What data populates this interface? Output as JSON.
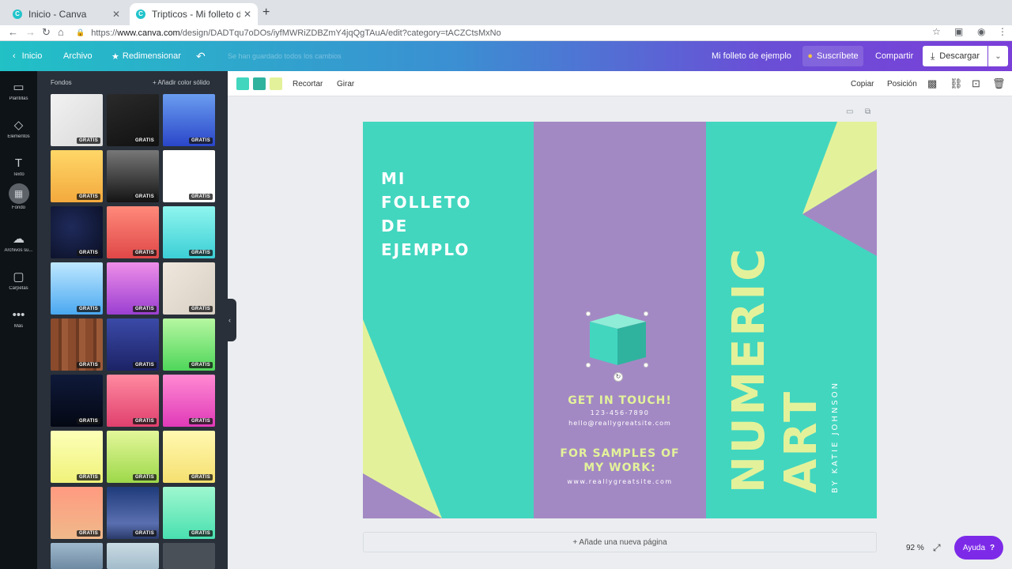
{
  "browser": {
    "tabs": [
      {
        "title": "Inicio - Canva"
      },
      {
        "title": "Tripticos - Mi folleto de ejemplo"
      }
    ],
    "url_prefix": "https://",
    "url_domain": "www.canva.com",
    "url_path": "/design/DADTqu7oDOs/iyfMWRiZDBZmY4jqQgTAuA/edit?category=tACZCtsMxNo"
  },
  "topbar": {
    "inicio": "Inicio",
    "archivo": "Archivo",
    "redimensionar": "Redimensionar",
    "saved_status": "Se han guardado todos los cambios",
    "design_title": "Mi folleto de ejemplo",
    "suscribete": "Suscríbete",
    "compartir": "Compartir",
    "descargar": "Descargar"
  },
  "rail": {
    "items": [
      {
        "label": "Plantillas",
        "icon": "template-icon"
      },
      {
        "label": "Elementos",
        "icon": "elements-icon"
      },
      {
        "label": "Texto",
        "icon": "text-icon"
      },
      {
        "label": "Fondo",
        "icon": "background-icon"
      },
      {
        "label": "Archivos su...",
        "icon": "upload-cloud-icon"
      },
      {
        "label": "Carpetas",
        "icon": "folder-icon"
      },
      {
        "label": "Más",
        "icon": "more-icon"
      }
    ]
  },
  "panel": {
    "heading": "Fondos",
    "add_solid": "+ Añadir color sólido",
    "badge": "GRATIS"
  },
  "toolbar": {
    "swatches": [
      "#42d6bf",
      "#2fb39e",
      "#e3f29a"
    ],
    "recortar": "Recortar",
    "girar": "Girar",
    "copiar": "Copiar",
    "posicion": "Posición"
  },
  "design": {
    "title_lines": [
      "MI",
      "FOLLETO",
      "DE",
      "EJEMPLO"
    ],
    "get_in_touch": "GET IN TOUCH!",
    "phone": "123-456-7890",
    "email": "hello@reallygreatsite.com",
    "samples_line1": "FOR SAMPLES OF",
    "samples_line2": "MY WORK:",
    "website": "www.reallygreatsite.com",
    "vertical_1": "NUMERIC",
    "vertical_2": "ART",
    "byline": "BY KATIE JOHNSON",
    "colors": {
      "teal": "#42d6bf",
      "purple": "#a389c4",
      "yellow": "#e3f29a",
      "white": "#ffffff"
    }
  },
  "footer": {
    "add_page": "+ Añade una nueva página",
    "zoom": "92 %",
    "help": "Ayuda"
  }
}
